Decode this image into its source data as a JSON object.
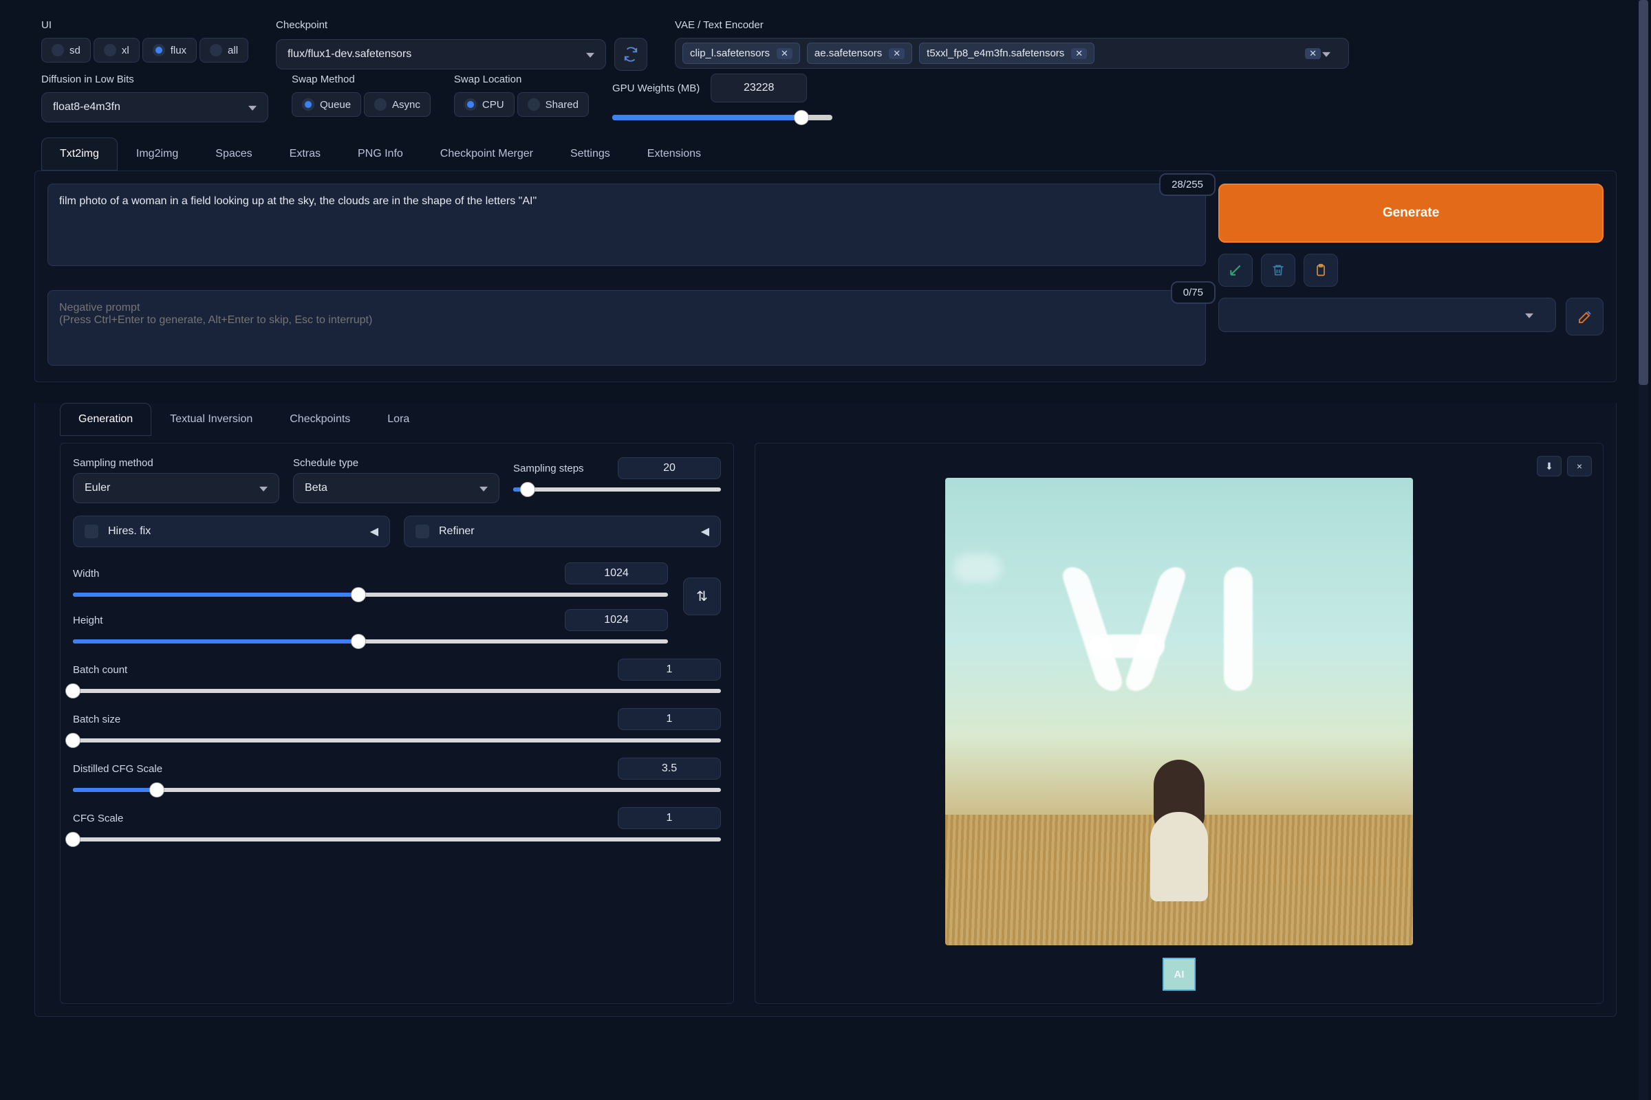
{
  "top": {
    "ui_label": "UI",
    "ui_options": [
      {
        "value": "sd",
        "checked": false
      },
      {
        "value": "xl",
        "checked": false
      },
      {
        "value": "flux",
        "checked": true
      },
      {
        "value": "all",
        "checked": false
      }
    ],
    "checkpoint_label": "Checkpoint",
    "checkpoint_value": "flux/flux1-dev.safetensors",
    "vae_label": "VAE / Text Encoder",
    "vae_chips": [
      "clip_l.safetensors",
      "ae.safetensors",
      "t5xxl_fp8_e4m3fn.safetensors"
    ]
  },
  "row2": {
    "lowbits_label": "Diffusion in Low Bits",
    "lowbits_value": "float8-e4m3fn",
    "swap_method_label": "Swap Method",
    "swap_method": [
      {
        "value": "Queue",
        "checked": true
      },
      {
        "value": "Async",
        "checked": false
      }
    ],
    "swap_loc_label": "Swap Location",
    "swap_loc": [
      {
        "value": "CPU",
        "checked": true
      },
      {
        "value": "Shared",
        "checked": false
      }
    ],
    "gpu_label": "GPU Weights (MB)",
    "gpu_value": "23228",
    "gpu_fill_pct": 86
  },
  "tabs": [
    "Txt2img",
    "Img2img",
    "Spaces",
    "Extras",
    "PNG Info",
    "Checkpoint Merger",
    "Settings",
    "Extensions"
  ],
  "active_tab": "Txt2img",
  "prompt": {
    "text": "film photo of a woman in a field looking up at the sky, the clouds are in the shape of the letters \"AI\"",
    "count": "28/255",
    "neg_placeholder": "Negative prompt\n(Press Ctrl+Enter to generate, Alt+Enter to skip, Esc to interrupt)",
    "neg_count": "0/75"
  },
  "actions": {
    "generate": "Generate"
  },
  "subtabs": [
    "Generation",
    "Textual Inversion",
    "Checkpoints",
    "Lora"
  ],
  "active_subtab": "Generation",
  "gen": {
    "sampling_method_label": "Sampling method",
    "sampling_method": "Euler",
    "schedule_label": "Schedule type",
    "schedule": "Beta",
    "steps_label": "Sampling steps",
    "steps": "20",
    "steps_fill": 7,
    "hires": "Hires. fix",
    "refiner": "Refiner",
    "width_label": "Width",
    "width": "1024",
    "width_fill": 48,
    "height_label": "Height",
    "height": "1024",
    "height_fill": 48,
    "batch_count_label": "Batch count",
    "batch_count": "1",
    "batch_count_fill": 0,
    "batch_size_label": "Batch size",
    "batch_size": "1",
    "batch_size_fill": 0,
    "dcfg_label": "Distilled CFG Scale",
    "dcfg": "3.5",
    "dcfg_fill": 13,
    "cfg_label": "CFG Scale",
    "cfg": "1",
    "cfg_fill": 0
  },
  "output": {
    "thumb_text": "AI",
    "close": "×",
    "download": "⬇"
  }
}
